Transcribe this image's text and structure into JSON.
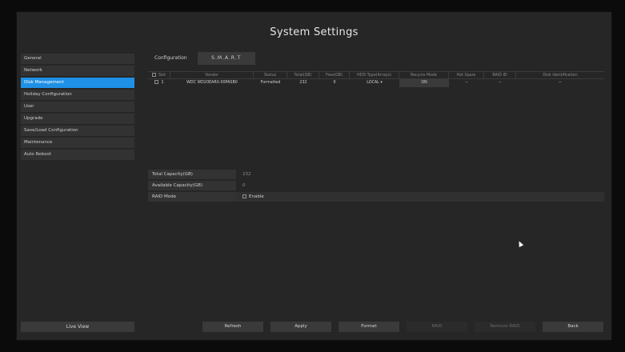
{
  "title": "System Settings",
  "sidebar": {
    "items": [
      {
        "label": "General",
        "active": false
      },
      {
        "label": "Network",
        "active": false
      },
      {
        "label": "Disk Management",
        "active": true
      },
      {
        "label": "Holiday Configuration",
        "active": false
      },
      {
        "label": "User",
        "active": false
      },
      {
        "label": "Upgrade",
        "active": false
      },
      {
        "label": "Save/Load Configuration",
        "active": false
      },
      {
        "label": "Maintenance",
        "active": false
      },
      {
        "label": "Auto Reboot",
        "active": false
      }
    ],
    "live_view": "Live View"
  },
  "tabs": [
    {
      "label": "Configuration"
    },
    {
      "label": "S.M.A.R.T"
    }
  ],
  "table": {
    "headers": [
      "Slot",
      "Vendor",
      "Status",
      "Total(GB)",
      "Free(GB)",
      "HDD Type(Arrays)",
      "Recycle Mode",
      "Hot Spare",
      "RAID ID",
      "Disk Identification"
    ],
    "rows": [
      {
        "slot": "1",
        "vendor": "WDC WD20EARX-00PASB0",
        "status": "Formatted",
        "total": "232",
        "free": "0",
        "hdd_type": "LOCAL",
        "recycle": "ON",
        "hot_spare": "--",
        "raid_id": "--",
        "disk_id": "--"
      }
    ]
  },
  "info": {
    "total_capacity_label": "Total Capacity(GB)",
    "total_capacity_value": "232",
    "available_capacity_label": "Available Capacity(GB)",
    "available_capacity_value": "0",
    "raid_mode_label": "RAID Mode",
    "raid_enable_label": "Enable"
  },
  "buttons": {
    "refresh": "Refresh",
    "apply": "Apply",
    "format": "Format",
    "raid": "RAID",
    "remove_raid": "Remove RAID",
    "back": "Back"
  }
}
